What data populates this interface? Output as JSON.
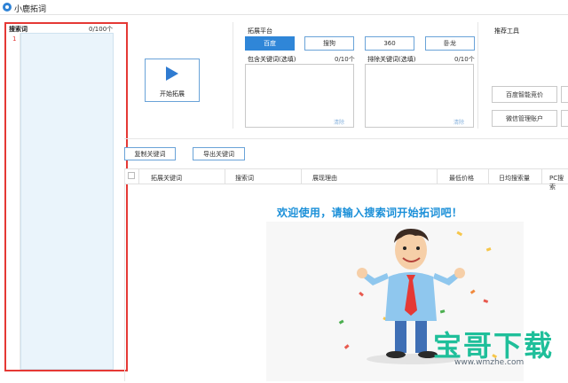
{
  "app": {
    "title": "小鹿拓词"
  },
  "left_panel": {
    "label": "搜索词",
    "count": "0/100个",
    "line_number": "1"
  },
  "start": {
    "label": "开始拓展"
  },
  "platform": {
    "title": "拓展平台",
    "options": [
      "百度",
      "搜狗",
      "360",
      "卧龙"
    ],
    "selected": "百度"
  },
  "include": {
    "title": "包含关键词(选填)",
    "count": "0/10个",
    "clear": "清除"
  },
  "exclude": {
    "title": "排除关键词(选填)",
    "count": "0/10个",
    "clear": "清除"
  },
  "tools": {
    "title": "推荐工具",
    "buttons": [
      "百度智能竞价",
      "微信管理账户"
    ]
  },
  "actions": {
    "copy": "复制关键词",
    "export": "导出关键词"
  },
  "table": {
    "columns": [
      "拓展关键词",
      "搜索词",
      "展现理由",
      "最低价格",
      "日均搜索量",
      "PC搜索"
    ]
  },
  "welcome": {
    "message": "欢迎使用，请输入搜索词开始拓词吧！"
  },
  "watermark": {
    "text": "宝哥下载",
    "url": "www.wmzhe.com"
  },
  "colors": {
    "accent": "#2f86d8",
    "highlight_border": "#e53935",
    "welcome": "#1a8fd8"
  }
}
